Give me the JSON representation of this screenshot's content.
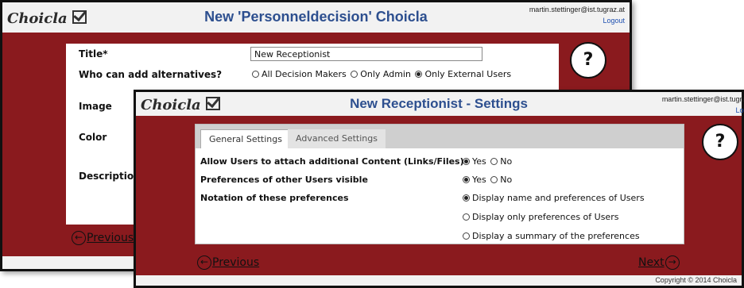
{
  "win1": {
    "logo": "Choicla",
    "title": "New 'Personneldecision' Choicla",
    "user_email": "martin.stettinger@ist.tugraz.at",
    "logout": "Logout",
    "help": "?",
    "fields": {
      "title_label": "Title*",
      "title_value": "New Receptionist",
      "who_label": "Who can add alternatives?",
      "who_options": [
        "All Decision Makers",
        "Only Admin",
        "Only External Users"
      ],
      "who_selected": 2,
      "image_label": "Image",
      "color_label": "Color",
      "description_label": "Description"
    },
    "previous": "Previous"
  },
  "win2": {
    "logo": "Choicla",
    "title": "New Receptionist - Settings",
    "user_email": "martin.stettinger@ist.tugraz.at",
    "logout": "Logout",
    "help": "?",
    "tabs": [
      "General Settings",
      "Advanced Settings"
    ],
    "settings": {
      "attach_label": "Allow Users to attach additional Content (Links/Files)",
      "prefs_visible_label": "Preferences of other Users visible",
      "notation_label": "Notation of these preferences",
      "yes": "Yes",
      "no": "No",
      "notation_options": [
        "Display name and preferences of Users",
        "Display only preferences of Users",
        "Display a summary of the preferences"
      ]
    },
    "previous": "Previous",
    "next": "Next",
    "copyright": "Copyright © 2014 Choicla"
  }
}
